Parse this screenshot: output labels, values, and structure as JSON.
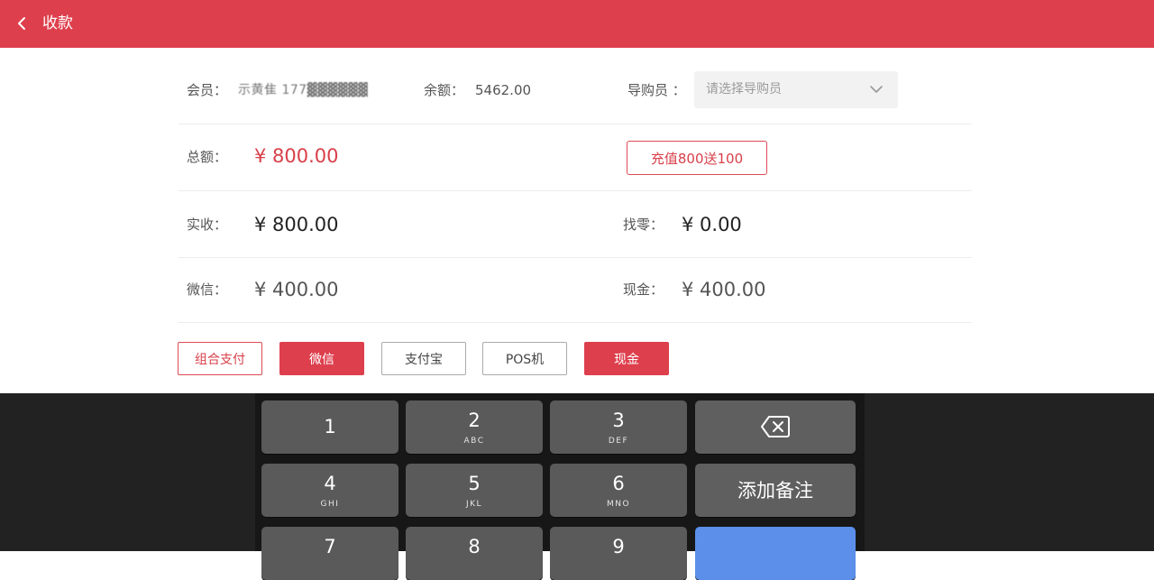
{
  "header": {
    "title": "收款",
    "back_icon": "chevron-left-icon",
    "bg_color": "#de3f4d"
  },
  "member": {
    "label": "会员：",
    "name_masked": "示黄隹  177▓▓▓▓▓▓",
    "balance_label": "余额：",
    "balance": "5462.00",
    "guide_label": "导购员 ：",
    "guide_placeholder": "请选择导购员"
  },
  "total": {
    "label": "总额：",
    "amount": "¥ 800.00",
    "promo_button": "充值800送100"
  },
  "received": {
    "label": "实收：",
    "amount": "¥ 800.00",
    "change_label": "找零：",
    "change_amount": "¥ 0.00"
  },
  "split": {
    "wechat_label": "微信：",
    "wechat_amount": "¥ 400.00",
    "cash_label": "现金：",
    "cash_amount": "¥ 400.00"
  },
  "pay_methods": [
    {
      "label": "组合支付",
      "state": "outline-red"
    },
    {
      "label": "微信",
      "state": "selected"
    },
    {
      "label": "支付宝",
      "state": "normal"
    },
    {
      "label": "POS机",
      "state": "normal"
    },
    {
      "label": "现金",
      "state": "selected"
    }
  ],
  "keypad": {
    "keys": [
      {
        "num": "1",
        "letters": ""
      },
      {
        "num": "2",
        "letters": "ABC"
      },
      {
        "num": "3",
        "letters": "DEF"
      },
      {
        "num": "4",
        "letters": "GHI"
      },
      {
        "num": "5",
        "letters": "JKL"
      },
      {
        "num": "6",
        "letters": "MNO"
      },
      {
        "num": "7",
        "letters": ""
      },
      {
        "num": "8",
        "letters": ""
      },
      {
        "num": "9",
        "letters": ""
      }
    ],
    "backspace_icon": "backspace-icon",
    "add_note": "添加备注"
  }
}
